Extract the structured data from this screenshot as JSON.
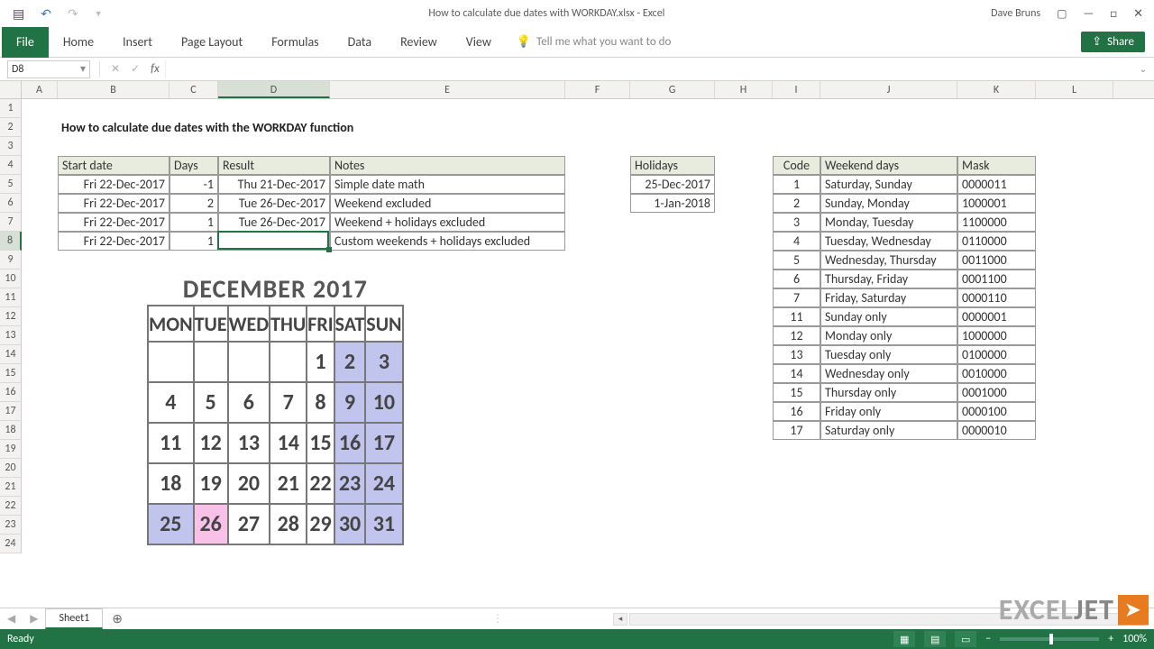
{
  "app": {
    "title": "How to calculate due dates with WORKDAY.xlsx - Excel",
    "user": "Dave Bruns",
    "status": "Ready",
    "zoom": "100%",
    "tellme_placeholder": "Tell me what you want to do"
  },
  "qat": {
    "save": "💾"
  },
  "tabs": [
    "File",
    "Home",
    "Insert",
    "Page Layout",
    "Formulas",
    "Data",
    "Review",
    "View"
  ],
  "share": "Share",
  "namebox": "D8",
  "formula": "",
  "sheet": {
    "name": "Sheet1"
  },
  "columns": [
    "A",
    "B",
    "C",
    "D",
    "E",
    "F",
    "G",
    "H",
    "I",
    "J",
    "K",
    "L"
  ],
  "heading": "How to calculate due dates with the WORKDAY function",
  "table1": {
    "headers": [
      "Start date",
      "Days",
      "Result",
      "Notes"
    ],
    "rows": [
      [
        "Fri 22-Dec-2017",
        "-1",
        "Thu 21-Dec-2017",
        "Simple date math"
      ],
      [
        "Fri 22-Dec-2017",
        "2",
        "Tue 26-Dec-2017",
        "Weekend excluded"
      ],
      [
        "Fri 22-Dec-2017",
        "1",
        "Tue 26-Dec-2017",
        "Weekend + holidays excluded"
      ],
      [
        "Fri 22-Dec-2017",
        "1",
        "",
        "Custom weekends + holidays excluded"
      ]
    ]
  },
  "holidays": {
    "header": "Holidays",
    "rows": [
      "25-Dec-2017",
      "1-Jan-2018"
    ]
  },
  "codetbl": {
    "headers": [
      "Code",
      "Weekend days",
      "Mask"
    ],
    "rows": [
      [
        "1",
        "Saturday, Sunday",
        "0000011"
      ],
      [
        "2",
        "Sunday, Monday",
        "1000001"
      ],
      [
        "3",
        "Monday, Tuesday",
        "1100000"
      ],
      [
        "4",
        "Tuesday, Wednesday",
        "0110000"
      ],
      [
        "5",
        "Wednesday, Thursday",
        "0011000"
      ],
      [
        "6",
        "Thursday, Friday",
        "0001100"
      ],
      [
        "7",
        "Friday, Saturday",
        "0000110"
      ],
      [
        "11",
        "Sunday only",
        "0000001"
      ],
      [
        "12",
        "Monday only",
        "1000000"
      ],
      [
        "13",
        "Tuesday only",
        "0100000"
      ],
      [
        "14",
        "Wednesday only",
        "0010000"
      ],
      [
        "15",
        "Thursday only",
        "0001000"
      ],
      [
        "16",
        "Friday only",
        "0000100"
      ],
      [
        "17",
        "Saturday only",
        "0000010"
      ]
    ]
  },
  "calendar": {
    "title": "DECEMBER 2017",
    "days": [
      "MON",
      "TUE",
      "WED",
      "THU",
      "FRI",
      "SAT",
      "SUN"
    ],
    "weeks": [
      [
        "",
        "",
        "",
        "",
        "1",
        "2",
        "3"
      ],
      [
        "4",
        "5",
        "6",
        "7",
        "8",
        "9",
        "10"
      ],
      [
        "11",
        "12",
        "13",
        "14",
        "15",
        "16",
        "17"
      ],
      [
        "18",
        "19",
        "20",
        "21",
        "22",
        "23",
        "24"
      ],
      [
        "25",
        "26",
        "27",
        "28",
        "29",
        "30",
        "31"
      ]
    ]
  },
  "watermark": {
    "t1": "EXCEL",
    "t2": "JET"
  }
}
